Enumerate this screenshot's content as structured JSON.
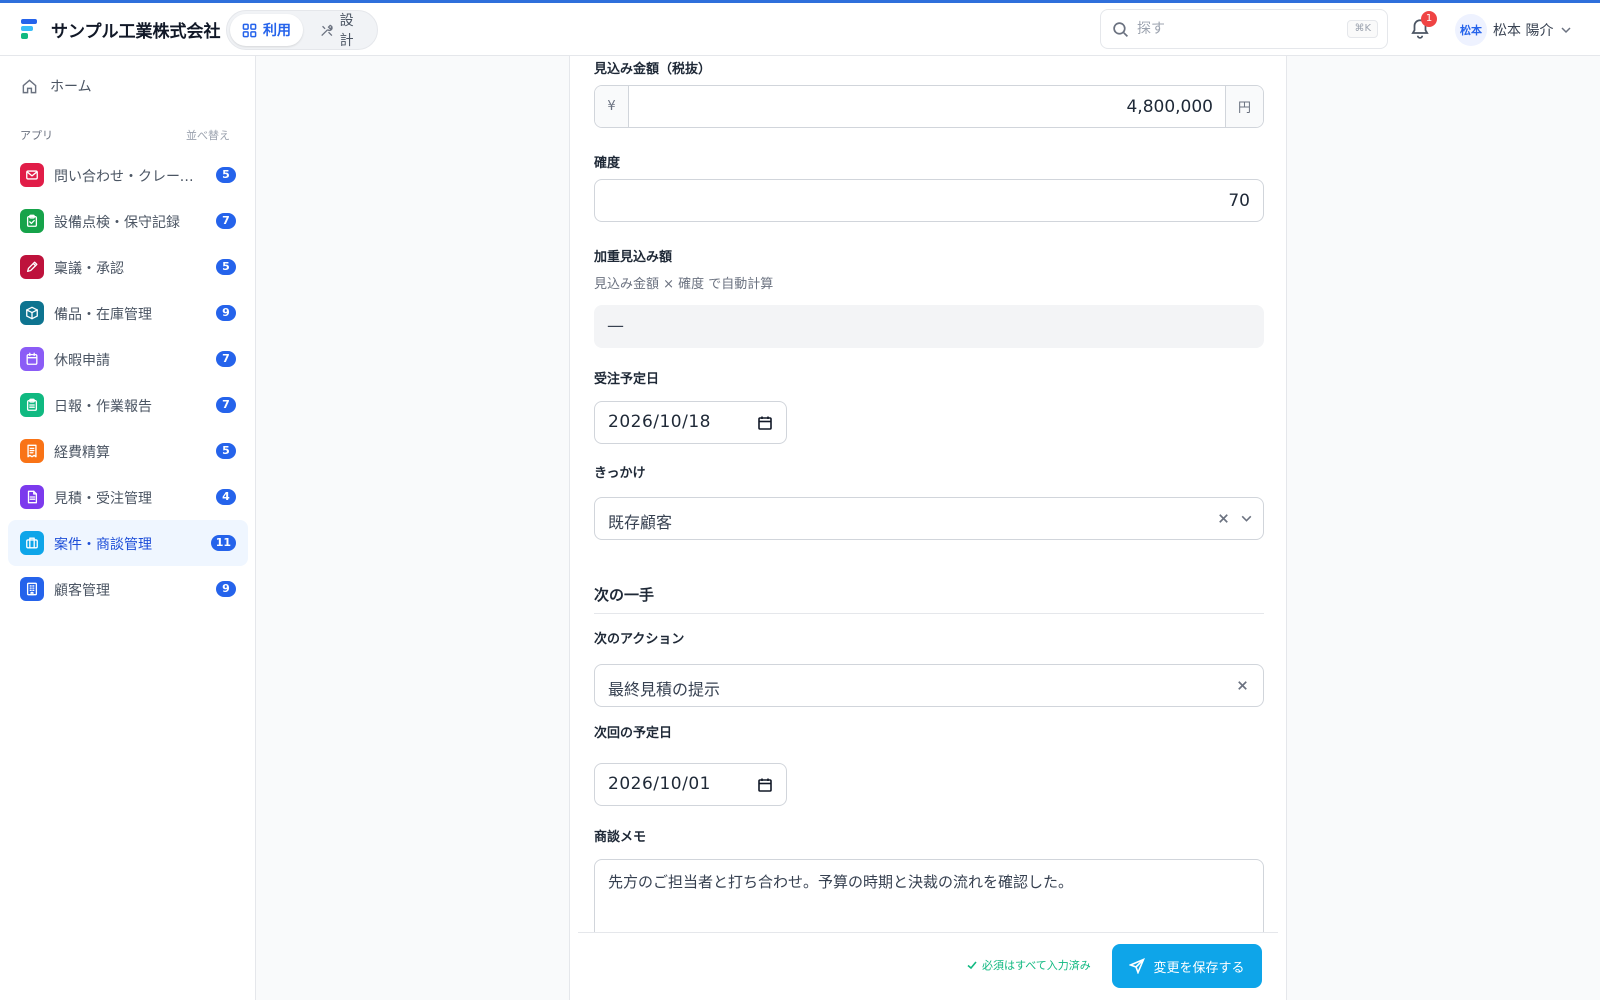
{
  "header": {
    "company": "サンプル工業株式会社",
    "mode_use": "利用",
    "mode_design": "設計",
    "search_placeholder": "探す",
    "search_shortcut": "⌘K",
    "notification_count": "1",
    "avatar_text": "松本",
    "user_name": "松本 陽介"
  },
  "sidebar": {
    "home": "ホーム",
    "apps_heading": "アプリ",
    "sort_label": "並べ替え",
    "apps": [
      {
        "label": "問い合わせ・クレーム管理",
        "count": "5",
        "color": "#e11d48",
        "icon": "mail-icon"
      },
      {
        "label": "設備点検・保守記録",
        "count": "7",
        "color": "#16a34a",
        "icon": "clipboard-check-icon"
      },
      {
        "label": "稟議・承認",
        "count": "5",
        "color": "#be123c",
        "icon": "pen-icon"
      },
      {
        "label": "備品・在庫管理",
        "count": "9",
        "color": "#0e7490",
        "icon": "box-icon"
      },
      {
        "label": "休暇申請",
        "count": "7",
        "color": "#8b5cf6",
        "icon": "calendar-icon"
      },
      {
        "label": "日報・作業報告",
        "count": "7",
        "color": "#10b981",
        "icon": "clipboard-icon"
      },
      {
        "label": "経費精算",
        "count": "5",
        "color": "#f97316",
        "icon": "receipt-icon"
      },
      {
        "label": "見積・受注管理",
        "count": "4",
        "color": "#7c3aed",
        "icon": "document-icon"
      },
      {
        "label": "案件・商談管理",
        "count": "11",
        "color": "#0ea5e9",
        "icon": "briefcase-icon",
        "active": true
      },
      {
        "label": "顧客管理",
        "count": "9",
        "color": "#2563eb",
        "icon": "building-icon"
      }
    ]
  },
  "form": {
    "amount_label": "見込み金額（税抜）",
    "amount_prefix": "¥",
    "amount_value": "4,800,000",
    "amount_suffix": "円",
    "probability_label": "確度",
    "probability_value": "70",
    "weighted_label": "加重見込み額",
    "weighted_help": "見込み金額 × 確度 で自動計算",
    "weighted_value": "—",
    "order_date_label": "受注予定日",
    "order_date_value": "2026/10/18",
    "trigger_label": "きっかけ",
    "trigger_value": "既存顧客",
    "section_next": "次の一手",
    "next_action_label": "次のアクション",
    "next_action_value": "最終見積の提示",
    "next_date_label": "次回の予定日",
    "next_date_value": "2026/10/01",
    "memo_label": "商談メモ",
    "memo_value": "先方のご担当者と打ち合わせ。予算の時期と決裁の流れを確認した。"
  },
  "footer": {
    "required_status": "必須はすべて入力済み",
    "save_label": "変更を保存する"
  },
  "colors": {
    "accent": "#2563eb",
    "save_button": "#0ea5e9",
    "success": "#10b981",
    "badge": "#ef4444"
  }
}
